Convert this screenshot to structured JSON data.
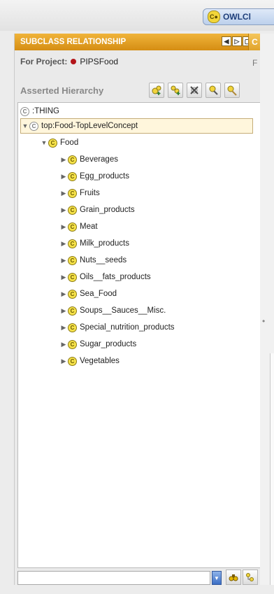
{
  "toolbar": {
    "owl_tab_label": "OWLCl",
    "owl_tab_icon_text": "C"
  },
  "panel": {
    "title": "SUBCLASS RELATIONSHIP",
    "right_header_letter": "C",
    "project_label": "For Project:",
    "project_name": "PIPSFood",
    "right_project_fragment": "F",
    "hierarchy_label": "Asserted Hierarchy"
  },
  "tree": {
    "root": {
      "label": ":THING",
      "icon": "C"
    },
    "top": {
      "label": "top:Food-TopLevelConcept",
      "icon": "C"
    },
    "food": {
      "label": "Food",
      "icon": "C"
    },
    "children": [
      {
        "label": "Beverages",
        "icon": "C"
      },
      {
        "label": "Egg_products",
        "icon": "C"
      },
      {
        "label": "Fruits",
        "icon": "C"
      },
      {
        "label": "Grain_products",
        "icon": "C"
      },
      {
        "label": "Meat",
        "icon": "C"
      },
      {
        "label": "Milk_products",
        "icon": "C"
      },
      {
        "label": "Nuts__seeds",
        "icon": "C"
      },
      {
        "label": "Oils__fats_products",
        "icon": "C"
      },
      {
        "label": "Sea_Food",
        "icon": "C"
      },
      {
        "label": "Soups__Sauces__Misc.",
        "icon": "C"
      },
      {
        "label": "Special_nutrition_products",
        "icon": "C"
      },
      {
        "label": "Sugar_products",
        "icon": "C"
      },
      {
        "label": "Vegetables",
        "icon": "C"
      }
    ]
  },
  "search": {
    "value": ""
  },
  "colors": {
    "header_orange": "#e39d20",
    "class_icon": "#f6e24a",
    "selected_bg": "#fff6dc",
    "project_dot": "#b3151a"
  }
}
